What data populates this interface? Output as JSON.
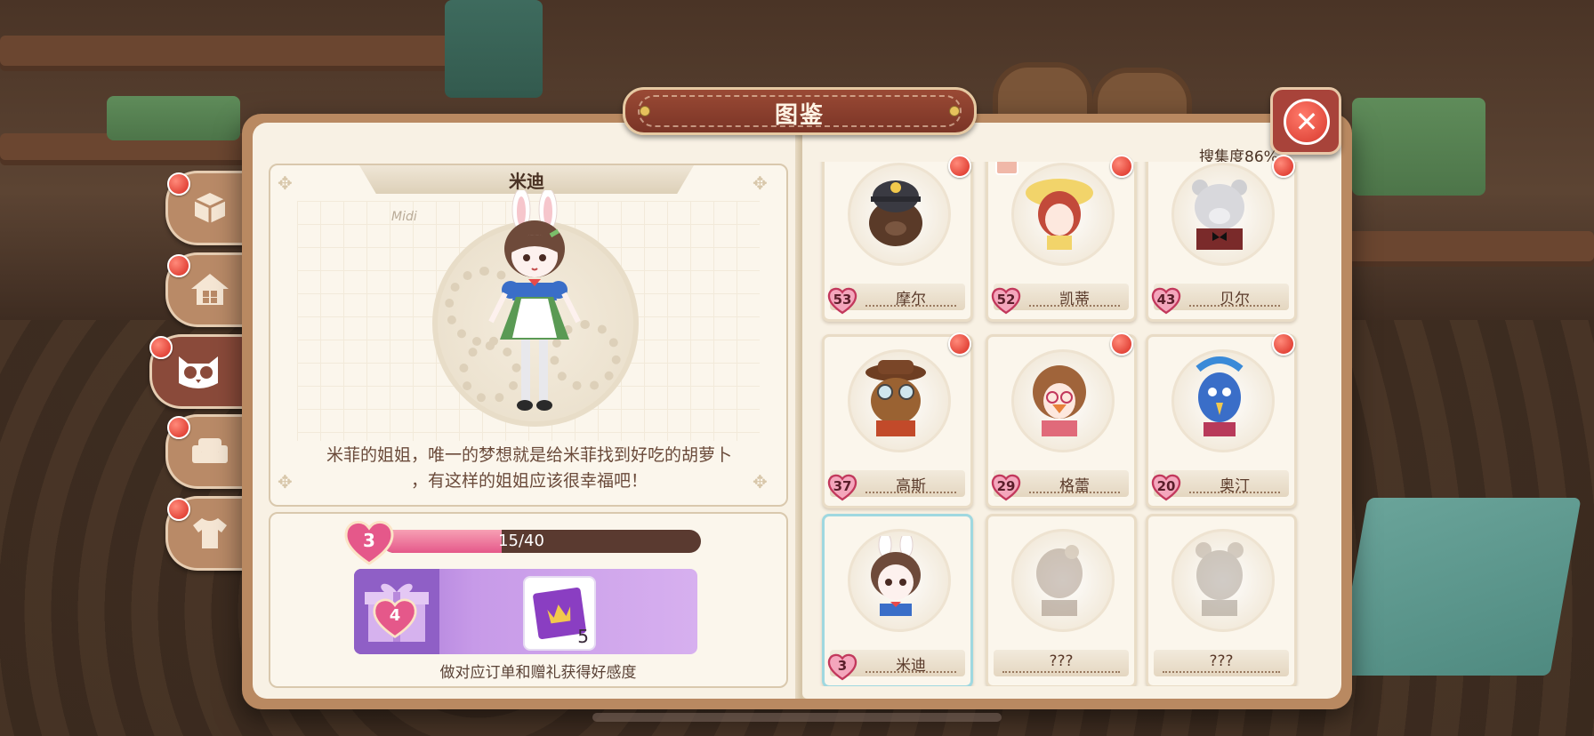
{
  "window": {
    "title": "图鉴"
  },
  "collection": {
    "label": "搜集度86%"
  },
  "tabs": [
    {
      "icon": "box-icon",
      "active": false
    },
    {
      "icon": "house-icon",
      "active": false
    },
    {
      "icon": "owl-icon",
      "active": true
    },
    {
      "icon": "sofa-icon",
      "active": false
    },
    {
      "icon": "shirt-icon",
      "active": false
    }
  ],
  "character": {
    "name": "米迪",
    "signature": "Midi",
    "description_line1": "米菲的姐姐，唯一的梦想就是给米菲找到好吃的胡萝卜",
    "description_line2": "，有这样的姐姐应该很幸福吧！"
  },
  "affinity": {
    "level": "3",
    "progress": "15/40",
    "progress_fraction": 0.375,
    "next_level": "4",
    "ticket_count": "5",
    "hint": "做对应订单和赠礼获得好感度"
  },
  "cards": [
    {
      "name": "摩尔",
      "level": "53",
      "dot": true
    },
    {
      "name": "凯蒂",
      "level": "52",
      "dot": true
    },
    {
      "name": "贝尔",
      "level": "43",
      "dot": true
    },
    {
      "name": "高斯",
      "level": "37",
      "dot": true
    },
    {
      "name": "格蕾",
      "level": "29",
      "dot": true
    },
    {
      "name": "奥汀",
      "level": "20",
      "dot": true
    },
    {
      "name": "米迪",
      "level": "3",
      "dot": false
    },
    {
      "name": "???",
      "level": "",
      "dot": false
    },
    {
      "name": "???",
      "level": "",
      "dot": false
    }
  ],
  "colors": {
    "accent": "#8a4a3a",
    "badge": "#d82a20",
    "pink": "#e5588a",
    "purple": "#c79ae8"
  }
}
